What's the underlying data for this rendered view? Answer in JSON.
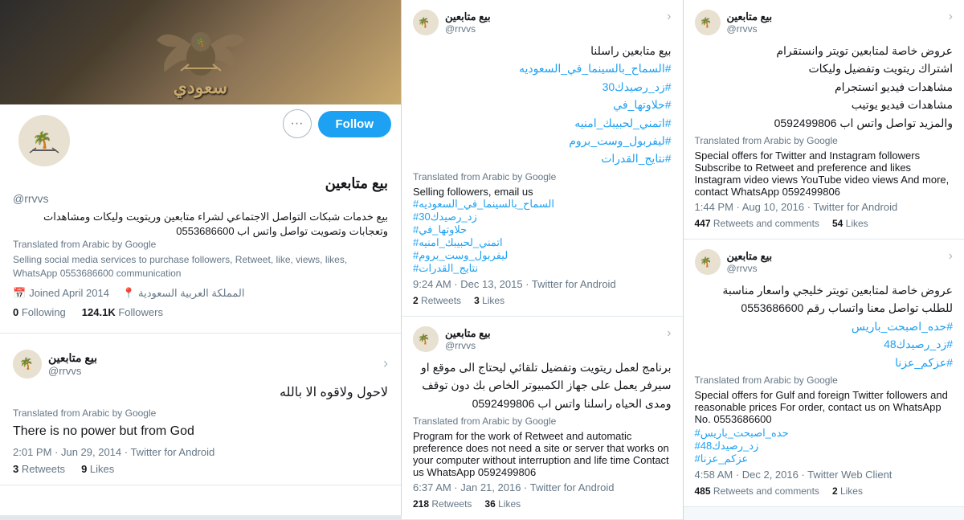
{
  "profile": {
    "name": "بيع متابعين",
    "handle": "@rrvvs",
    "bio_arabic": "بيع خدمات شبكات التواصل الاجتماعي لشراء متابعين وريتويت وليكات ومشاهدات وتعجابات وتصويت تواصل واتس اب 0553686600",
    "bio_translated_label": "Translated from Arabic by Google",
    "bio_translated": "Selling social media services to purchase followers, Retweet, like, views, likes, WhatsApp 0553686600 communication",
    "joined": "Joined April 2014",
    "location": "المملكة العربية السعودية",
    "following_count": "0",
    "following_label": "Following",
    "followers_count": "124.1K",
    "followers_label": "Followers",
    "follow_button": "Follow",
    "more_button": "···"
  },
  "left_tweet": {
    "text_arabic": "لاحول ولاقوه الا بالله",
    "translated_label": "Translated from Arabic by Google",
    "translated_text": "There is no power but from God",
    "timestamp": "2:01 PM · Jun 29, 2014 · Twitter for Android",
    "retweets": "3",
    "retweets_label": "Retweets",
    "likes": "9",
    "likes_label": "Likes"
  },
  "tweet1": {
    "author_name": "بيع متابعين",
    "author_handle": "@rrvvs",
    "text_arabic": "بيع متابعين راسلنا\n#السماح_بالسينما_في_السعوديه\n#زد_رصيدك30\n#حلاوتها_في\n#اتمني_لحبيبك_امنيه\n#ليفربول_وست_بروم\n#نتايج_القدرات",
    "hashtags": [
      "#السماح_بالسينما_في_السعوديه",
      "#زد_رصيدك30",
      "#حلاوتها_في",
      "#اتمني_لحبيبك_امنيه",
      "#ليفربول_وست_بروم",
      "#نتايج_القدرات"
    ],
    "translated_label": "Translated from Arabic by Google",
    "translated_text": "Selling followers, email us",
    "translated_hashtags": [
      "#السماح_بالسينما_في_السعوديه",
      "#زد_رصيدك30",
      "#حلاوتها_في",
      "#اتمني_لحبيبك_امنيه",
      "#ليفربول_وست_بروم",
      "#نتايج_القدرات"
    ],
    "timestamp": "9:24 AM · Dec 13, 2015 · Twitter for Android",
    "retweets": "2",
    "retweets_label": "Retweets",
    "likes": "3",
    "likes_label": "Likes"
  },
  "tweet2": {
    "author_name": "بيع متابعين",
    "author_handle": "@rrvvs",
    "text_arabic": "برنامج لعمل ريتويت وتفضيل تلقائي ليحتاج الى موقع او سيرفر يعمل على جهاز الكمبيوتر الخاص بك دون توقف ومدى الحياه راسلنا واتس اب 0592499806",
    "translated_label": "Translated from Arabic by Google",
    "translated_text": "Program for the work of Retweet and automatic preference does not need a site or server that works on your computer without interruption and life time Contact us WhatsApp 0592499806",
    "timestamp": "6:37 AM · Jan 21, 2016 · Twitter for Android",
    "retweets": "218",
    "retweets_label": "Retweets",
    "likes": "36",
    "likes_label": "Likes"
  },
  "tweet3": {
    "author_name": "بيع متابعين",
    "author_handle": "@rrvvs",
    "text_arabic": "عروض خاصة لمتابعين تويتر وانستقرام\nاشتراك ريتويت وتفضيل وليكات\nمشاهدات فيديو انستجرام\nمشاهدات فيديو يوتيب\nوالمزيد تواصل واتس اب 0592499806",
    "translated_label": "Translated from Arabic by Google",
    "translated_text": "Special offers for Twitter and Instagram followers Subscribe to Retweet and preference and likes Instagram video views YouTube video views And more, contact WhatsApp 0592499806",
    "timestamp": "1:44 PM · Aug 10, 2016 · Twitter for Android",
    "retweets": "447",
    "retweets_label": "Retweets and comments",
    "likes": "54",
    "likes_label": "Likes"
  },
  "tweet4": {
    "author_name": "بيع متابعين",
    "author_handle": "@rrvvs",
    "text_arabic": "عروض خاصة لمتابعين تويتر خليجي واسعار مناسبة للطلب تواصل معنا واتساب رقم 0553686600",
    "hashtags": [
      "#حده_اصبحت_باريس",
      "#زد_رصيدك48",
      "#عزكم_عزنا"
    ],
    "translated_label": "Translated from Arabic by Google",
    "translated_text": "Special offers for Gulf and foreign Twitter followers and reasonable prices For order, contact us on WhatsApp No. 0553686600",
    "translated_hashtags": [
      "#حده_اصبحت_باريس",
      "#زد_رصيدك48",
      "#عزكم_عزنا"
    ],
    "timestamp": "4:58 AM · Dec 2, 2016 · Twitter Web Client",
    "retweets": "485",
    "retweets_label": "Retweets and comments",
    "likes": "2",
    "likes_label": "Likes"
  }
}
